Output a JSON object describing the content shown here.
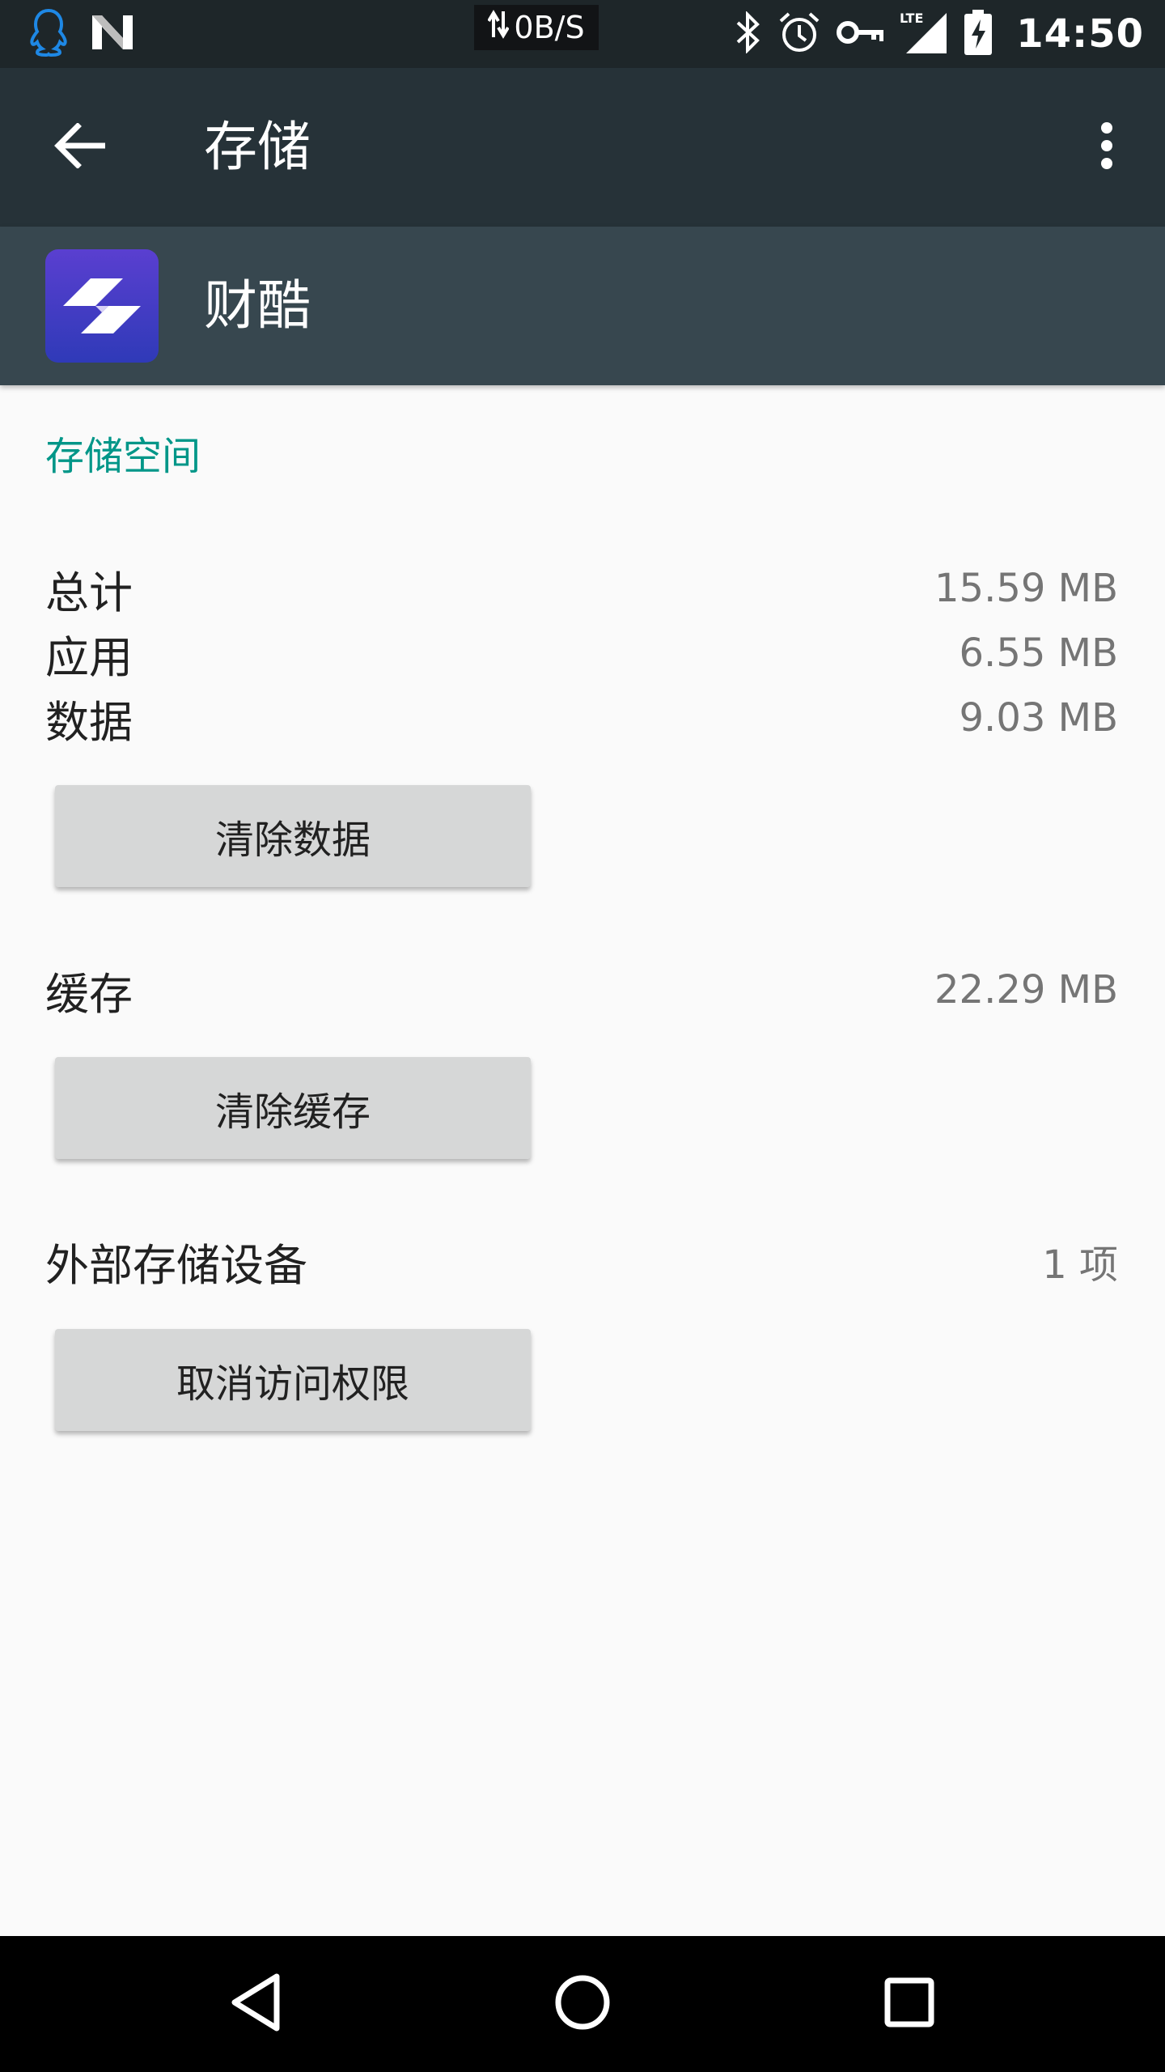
{
  "status_bar": {
    "network_speed": "0B/S",
    "network_type": "LTE",
    "time": "14:50",
    "icons": [
      "qq-icon",
      "n-icon",
      "data-arrows-icon",
      "bluetooth-icon",
      "alarm-icon",
      "vpn-key-icon",
      "signal-icon",
      "battery-charging-icon"
    ]
  },
  "toolbar": {
    "title": "存储"
  },
  "app": {
    "name": "财酷",
    "icon_colors": [
      "#5a3fd0",
      "#2f3ab8"
    ]
  },
  "storage": {
    "section_title": "存储空间",
    "rows": [
      {
        "label": "总计",
        "value": "15.59 MB"
      },
      {
        "label": "应用",
        "value": "6.55 MB"
      },
      {
        "label": "数据",
        "value": "9.03 MB"
      }
    ],
    "clear_data_label": "清除数据",
    "cache": {
      "label": "缓存",
      "value": "22.29 MB"
    },
    "clear_cache_label": "清除缓存",
    "external": {
      "label": "外部存储设备",
      "value": "1 项"
    },
    "revoke_access_label": "取消访问权限"
  },
  "colors": {
    "accent": "#009688",
    "toolbar": "#263238",
    "app_header": "#37474f",
    "status_bar": "#1e2629"
  }
}
